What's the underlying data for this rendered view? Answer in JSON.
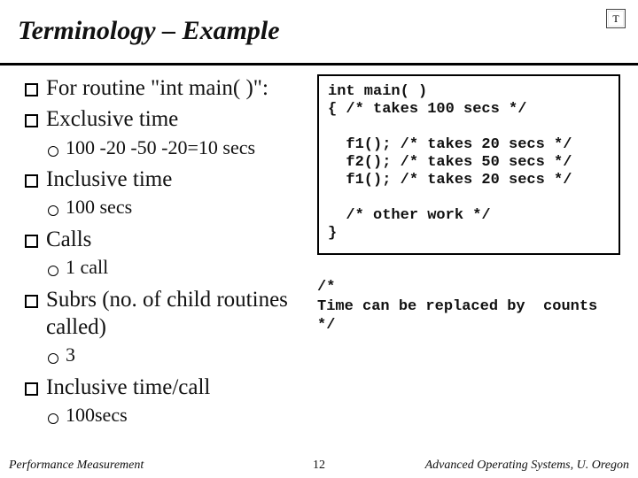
{
  "title": "Terminology – Example",
  "logo_glyph": "T",
  "bullets": {
    "b0": "For routine \"int main( )\":",
    "b1": "Exclusive time",
    "b1s": "100 -20 -50 -20=10 secs",
    "b2": "Inclusive time",
    "b2s": "100 secs",
    "b3": "Calls",
    "b3s": "1 call",
    "b4": "Subrs (no. of child routines called)",
    "b4s": "3",
    "b5": "Inclusive time/call",
    "b5s": "100secs"
  },
  "code": {
    "l0": "int main( )",
    "l1": "{ /* takes 100 secs */",
    "l2": "",
    "l3": "  f1(); /* takes 20 secs */",
    "l4": "  f2(); /* takes 50 secs */",
    "l5": "  f1(); /* takes 20 secs */",
    "l6": "",
    "l7": "  /* other work */",
    "l8": "}"
  },
  "code_after": "/*\nTime can be replaced by  counts\n*/",
  "footer": {
    "left": "Performance Measurement",
    "mid": "12",
    "right": "Advanced Operating Systems, U. Oregon"
  }
}
